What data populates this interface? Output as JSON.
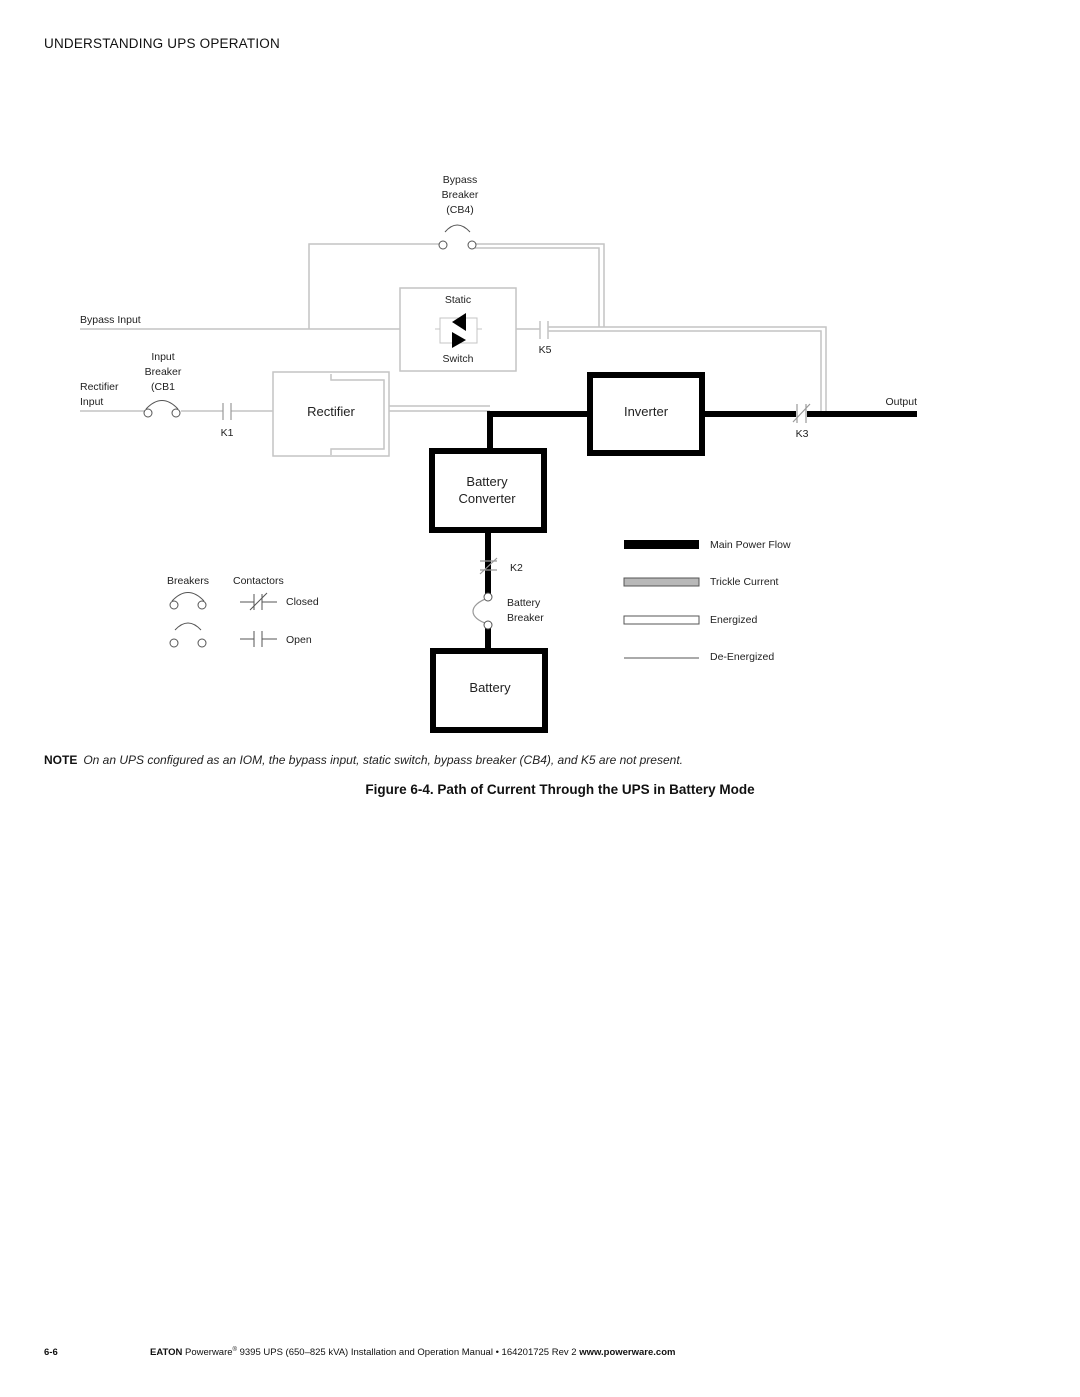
{
  "header": {
    "section_title": "UNDERSTANDING UPS OPERATION"
  },
  "diagram": {
    "labels": {
      "bypass_breaker": [
        "Bypass",
        "Breaker",
        "(CB4)"
      ],
      "static_switch_top": "Static",
      "static_switch_bottom": "Switch",
      "k5": "K5",
      "bypass_input": "Bypass Input",
      "input_breaker": [
        "Input",
        "Breaker",
        "(CB1"
      ],
      "rectifier_input": [
        "Rectifier",
        "Input"
      ],
      "k1": "K1",
      "rectifier": "Rectifier",
      "inverter": "Inverter",
      "output": "Output",
      "k3": "K3",
      "battery_converter": [
        "Battery",
        "Converter"
      ],
      "k2": "K2",
      "battery_breaker": [
        "Battery",
        "Breaker"
      ],
      "battery": "Battery"
    },
    "symbol_key": {
      "breakers_header": "Breakers",
      "contactors_header": "Contactors",
      "closed": "Closed",
      "open": "Open"
    },
    "legend": [
      {
        "label": "Main Power Flow",
        "style": "main"
      },
      {
        "label": "Trickle  Current",
        "style": "trickle"
      },
      {
        "label": "Energized",
        "style": "energized"
      },
      {
        "label": "De-Energized",
        "style": "deenergized"
      }
    ],
    "colors": {
      "main": "#000000",
      "trickle": "#b8b8b8",
      "line": "#bdbdbd"
    }
  },
  "note": {
    "label": "NOTE",
    "text": "On an UPS configured as an IOM, the bypass input, static switch, bypass breaker (CB4), and K5 are not present."
  },
  "caption": "Figure 6-4. Path of Current Through the UPS in Battery Mode",
  "footer": {
    "page": "6-6",
    "brand": "EATON",
    "product": "Powerware",
    "reg": "®",
    "rest": " 9395 UPS (650–825 kVA) Installation and Operation Manual  •  164201725 Rev 2 ",
    "url": "www.powerware.com"
  }
}
